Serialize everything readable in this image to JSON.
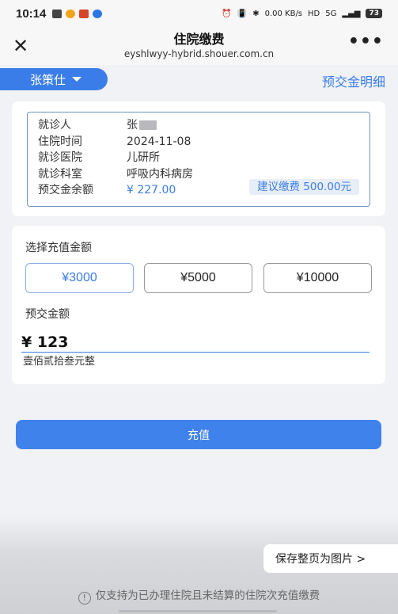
{
  "status_bar": {
    "time": "10:14",
    "network_speed": "0.00 KB/s",
    "battery": "73",
    "signal": "5G"
  },
  "navbar": {
    "title": "住院缴费",
    "url": "eyshlwyy-hybrid.shouer.com.cn",
    "close_icon": "close-icon",
    "more_icon": "more-icon"
  },
  "patient": {
    "selector_label": "张策仕",
    "detail_link": "预交金明细"
  },
  "info": {
    "rows": [
      {
        "label": "就诊人",
        "value": "张"
      },
      {
        "label": "住院时间",
        "value": "2024-11-08"
      },
      {
        "label": "就诊医院",
        "value": "儿研所"
      },
      {
        "label": "就诊科室",
        "value": "呼吸内科病房"
      },
      {
        "label": "预交金余额",
        "value": "¥ 227.00"
      }
    ],
    "suggestion": "建议缴费 500.00元"
  },
  "recharge": {
    "select_label": "选择充值金额",
    "options": [
      "¥3000",
      "¥5000",
      "¥10000"
    ],
    "selected_index": 0,
    "deposit_label": "预交金额",
    "amount_value": "¥ 123",
    "amount_words": "壹佰贰拾叁元整"
  },
  "actions": {
    "recharge_button": "充值",
    "save_page": "保存整页为图片 >"
  },
  "notice": {
    "icon": "!",
    "text": "仅支持为已办理住院且未结算的住院次充值缴费"
  },
  "colors": {
    "accent": "#3a7de8",
    "button": "#3f82ec",
    "background": "#f1f2f5"
  }
}
